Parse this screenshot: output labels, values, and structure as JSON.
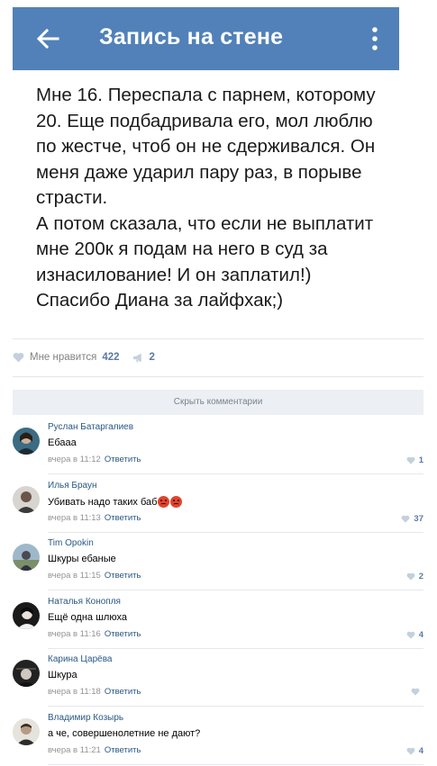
{
  "header": {
    "title": "Запись на стене",
    "background": "#5181b8",
    "back_icon": "arrow-left-icon",
    "menu_icon": "more-vertical-icon"
  },
  "post": {
    "lines": [
      "Мне 16. Переспала с парнем, которому",
      "20. Еще подбадривала его, мол люблю",
      "по жестче, чтоб он не сдерживался. Он",
      "меня даже ударил пару раз, в порыве",
      "страсти.",
      "А потом сказала, что если не выплатит",
      "мне 200к я подам на него в суд за",
      "изнасилование! И он заплатил!)",
      "Спасибо Диана за лайфхак;)"
    ],
    "like_label": "Мне нравится",
    "like_count": "422",
    "share_count": "2"
  },
  "comments_toggle": "Скрыть комментарии",
  "comments": [
    {
      "author": "Руслан Батаргалиев",
      "text": "Ебааа",
      "emoji_count": 0,
      "time": "вчера в 11:12",
      "reply": "Ответить",
      "likes": "1"
    },
    {
      "author": "Илья Браун",
      "text": "Убивать надо таких баб",
      "emoji_count": 2,
      "time": "вчера в 11:13",
      "reply": "Ответить",
      "likes": "37"
    },
    {
      "author": "Tim Opokin",
      "text": "Шкуры ебаные",
      "emoji_count": 0,
      "time": "вчера в 11:15",
      "reply": "Ответить",
      "likes": "2"
    },
    {
      "author": "Наталья Конопля",
      "text": "Ещё одна шлюха",
      "emoji_count": 0,
      "time": "вчера в 11:16",
      "reply": "Ответить",
      "likes": "4"
    },
    {
      "author": "Карина Царёва",
      "text": "Шкура",
      "emoji_count": 0,
      "time": "вчера в 11:18",
      "reply": "Ответить",
      "likes": ""
    },
    {
      "author": "Владимир Козырь",
      "text": "а че, совершенолетние не дают?",
      "emoji_count": 0,
      "time": "вчера в 11:21",
      "reply": "Ответить",
      "likes": "4"
    }
  ]
}
